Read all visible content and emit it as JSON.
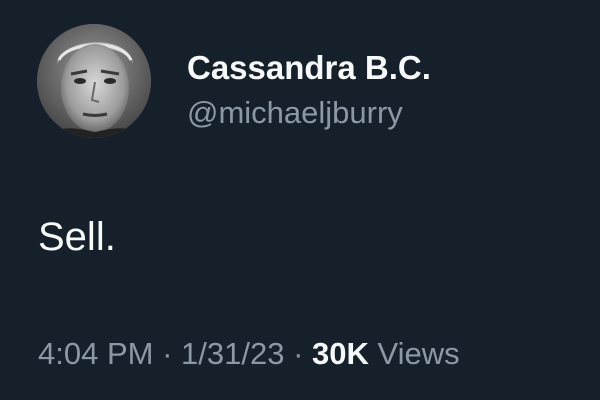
{
  "author": {
    "display_name": "Cassandra B.C.",
    "handle": "@michaeljburry",
    "avatar_icon": "avatar-photo"
  },
  "tweet": {
    "text": "Sell."
  },
  "meta": {
    "time": "4:04 PM",
    "separator": " · ",
    "date": "1/31/23",
    "views_count": "30K",
    "views_label": "Views"
  },
  "colors": {
    "background": "#15202b",
    "primary_text": "#f7f9f9",
    "secondary_text": "#8b98a5"
  }
}
